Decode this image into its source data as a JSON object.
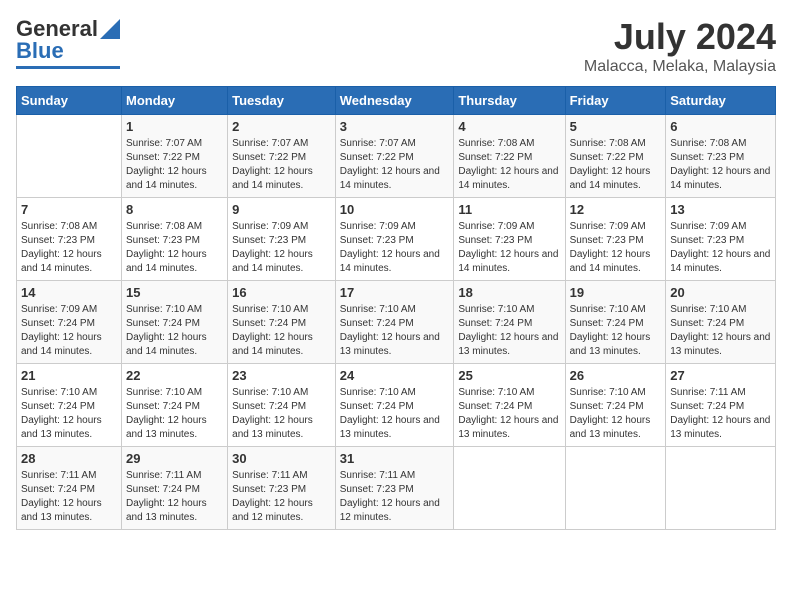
{
  "logo": {
    "line1": "General",
    "line2": "Blue"
  },
  "header": {
    "month_year": "July 2024",
    "location": "Malacca, Melaka, Malaysia"
  },
  "days_of_week": [
    "Sunday",
    "Monday",
    "Tuesday",
    "Wednesday",
    "Thursday",
    "Friday",
    "Saturday"
  ],
  "weeks": [
    [
      {
        "day": "",
        "sunrise": "",
        "sunset": "",
        "daylight": ""
      },
      {
        "day": "1",
        "sunrise": "Sunrise: 7:07 AM",
        "sunset": "Sunset: 7:22 PM",
        "daylight": "Daylight: 12 hours and 14 minutes."
      },
      {
        "day": "2",
        "sunrise": "Sunrise: 7:07 AM",
        "sunset": "Sunset: 7:22 PM",
        "daylight": "Daylight: 12 hours and 14 minutes."
      },
      {
        "day": "3",
        "sunrise": "Sunrise: 7:07 AM",
        "sunset": "Sunset: 7:22 PM",
        "daylight": "Daylight: 12 hours and 14 minutes."
      },
      {
        "day": "4",
        "sunrise": "Sunrise: 7:08 AM",
        "sunset": "Sunset: 7:22 PM",
        "daylight": "Daylight: 12 hours and 14 minutes."
      },
      {
        "day": "5",
        "sunrise": "Sunrise: 7:08 AM",
        "sunset": "Sunset: 7:22 PM",
        "daylight": "Daylight: 12 hours and 14 minutes."
      },
      {
        "day": "6",
        "sunrise": "Sunrise: 7:08 AM",
        "sunset": "Sunset: 7:23 PM",
        "daylight": "Daylight: 12 hours and 14 minutes."
      }
    ],
    [
      {
        "day": "7",
        "sunrise": "Sunrise: 7:08 AM",
        "sunset": "Sunset: 7:23 PM",
        "daylight": "Daylight: 12 hours and 14 minutes."
      },
      {
        "day": "8",
        "sunrise": "Sunrise: 7:08 AM",
        "sunset": "Sunset: 7:23 PM",
        "daylight": "Daylight: 12 hours and 14 minutes."
      },
      {
        "day": "9",
        "sunrise": "Sunrise: 7:09 AM",
        "sunset": "Sunset: 7:23 PM",
        "daylight": "Daylight: 12 hours and 14 minutes."
      },
      {
        "day": "10",
        "sunrise": "Sunrise: 7:09 AM",
        "sunset": "Sunset: 7:23 PM",
        "daylight": "Daylight: 12 hours and 14 minutes."
      },
      {
        "day": "11",
        "sunrise": "Sunrise: 7:09 AM",
        "sunset": "Sunset: 7:23 PM",
        "daylight": "Daylight: 12 hours and 14 minutes."
      },
      {
        "day": "12",
        "sunrise": "Sunrise: 7:09 AM",
        "sunset": "Sunset: 7:23 PM",
        "daylight": "Daylight: 12 hours and 14 minutes."
      },
      {
        "day": "13",
        "sunrise": "Sunrise: 7:09 AM",
        "sunset": "Sunset: 7:23 PM",
        "daylight": "Daylight: 12 hours and 14 minutes."
      }
    ],
    [
      {
        "day": "14",
        "sunrise": "Sunrise: 7:09 AM",
        "sunset": "Sunset: 7:24 PM",
        "daylight": "Daylight: 12 hours and 14 minutes."
      },
      {
        "day": "15",
        "sunrise": "Sunrise: 7:10 AM",
        "sunset": "Sunset: 7:24 PM",
        "daylight": "Daylight: 12 hours and 14 minutes."
      },
      {
        "day": "16",
        "sunrise": "Sunrise: 7:10 AM",
        "sunset": "Sunset: 7:24 PM",
        "daylight": "Daylight: 12 hours and 14 minutes."
      },
      {
        "day": "17",
        "sunrise": "Sunrise: 7:10 AM",
        "sunset": "Sunset: 7:24 PM",
        "daylight": "Daylight: 12 hours and 13 minutes."
      },
      {
        "day": "18",
        "sunrise": "Sunrise: 7:10 AM",
        "sunset": "Sunset: 7:24 PM",
        "daylight": "Daylight: 12 hours and 13 minutes."
      },
      {
        "day": "19",
        "sunrise": "Sunrise: 7:10 AM",
        "sunset": "Sunset: 7:24 PM",
        "daylight": "Daylight: 12 hours and 13 minutes."
      },
      {
        "day": "20",
        "sunrise": "Sunrise: 7:10 AM",
        "sunset": "Sunset: 7:24 PM",
        "daylight": "Daylight: 12 hours and 13 minutes."
      }
    ],
    [
      {
        "day": "21",
        "sunrise": "Sunrise: 7:10 AM",
        "sunset": "Sunset: 7:24 PM",
        "daylight": "Daylight: 12 hours and 13 minutes."
      },
      {
        "day": "22",
        "sunrise": "Sunrise: 7:10 AM",
        "sunset": "Sunset: 7:24 PM",
        "daylight": "Daylight: 12 hours and 13 minutes."
      },
      {
        "day": "23",
        "sunrise": "Sunrise: 7:10 AM",
        "sunset": "Sunset: 7:24 PM",
        "daylight": "Daylight: 12 hours and 13 minutes."
      },
      {
        "day": "24",
        "sunrise": "Sunrise: 7:10 AM",
        "sunset": "Sunset: 7:24 PM",
        "daylight": "Daylight: 12 hours and 13 minutes."
      },
      {
        "day": "25",
        "sunrise": "Sunrise: 7:10 AM",
        "sunset": "Sunset: 7:24 PM",
        "daylight": "Daylight: 12 hours and 13 minutes."
      },
      {
        "day": "26",
        "sunrise": "Sunrise: 7:10 AM",
        "sunset": "Sunset: 7:24 PM",
        "daylight": "Daylight: 12 hours and 13 minutes."
      },
      {
        "day": "27",
        "sunrise": "Sunrise: 7:11 AM",
        "sunset": "Sunset: 7:24 PM",
        "daylight": "Daylight: 12 hours and 13 minutes."
      }
    ],
    [
      {
        "day": "28",
        "sunrise": "Sunrise: 7:11 AM",
        "sunset": "Sunset: 7:24 PM",
        "daylight": "Daylight: 12 hours and 13 minutes."
      },
      {
        "day": "29",
        "sunrise": "Sunrise: 7:11 AM",
        "sunset": "Sunset: 7:24 PM",
        "daylight": "Daylight: 12 hours and 13 minutes."
      },
      {
        "day": "30",
        "sunrise": "Sunrise: 7:11 AM",
        "sunset": "Sunset: 7:23 PM",
        "daylight": "Daylight: 12 hours and 12 minutes."
      },
      {
        "day": "31",
        "sunrise": "Sunrise: 7:11 AM",
        "sunset": "Sunset: 7:23 PM",
        "daylight": "Daylight: 12 hours and 12 minutes."
      },
      {
        "day": "",
        "sunrise": "",
        "sunset": "",
        "daylight": ""
      },
      {
        "day": "",
        "sunrise": "",
        "sunset": "",
        "daylight": ""
      },
      {
        "day": "",
        "sunrise": "",
        "sunset": "",
        "daylight": ""
      }
    ]
  ]
}
